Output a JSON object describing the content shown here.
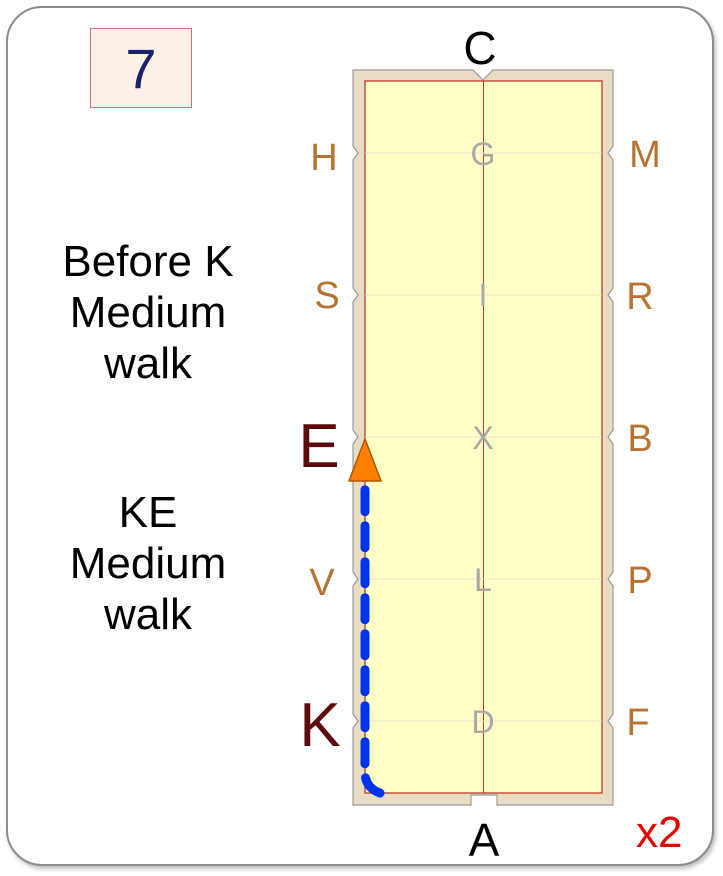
{
  "test_number": "7",
  "repeat_label": "x2",
  "instructions": [
    {
      "lines": [
        "Before K",
        "Medium",
        "walk"
      ]
    },
    {
      "lines": [
        "KE",
        "Medium",
        "walk"
      ]
    }
  ],
  "arena": {
    "end_letters": {
      "top": "C",
      "bottom": "A"
    },
    "left_letters": [
      "H",
      "S",
      "E",
      "V",
      "K"
    ],
    "right_letters": [
      "M",
      "R",
      "B",
      "P",
      "F"
    ],
    "centre_letters": [
      "G",
      "I",
      "X",
      "L",
      "D"
    ],
    "highlighted": [
      "E",
      "K"
    ]
  },
  "colors": {
    "arena_fill": "#ffffc6",
    "arena_border": "#e8dcc4",
    "track_letter": "#b87333",
    "highlight_letter": "#5c0a0a",
    "centre_letter": "#a8a8a8",
    "path": "#0033ee",
    "arrow": "#ff8000"
  },
  "path": {
    "gait": "Medium walk",
    "from": "K",
    "to": "E",
    "direction": "up"
  }
}
